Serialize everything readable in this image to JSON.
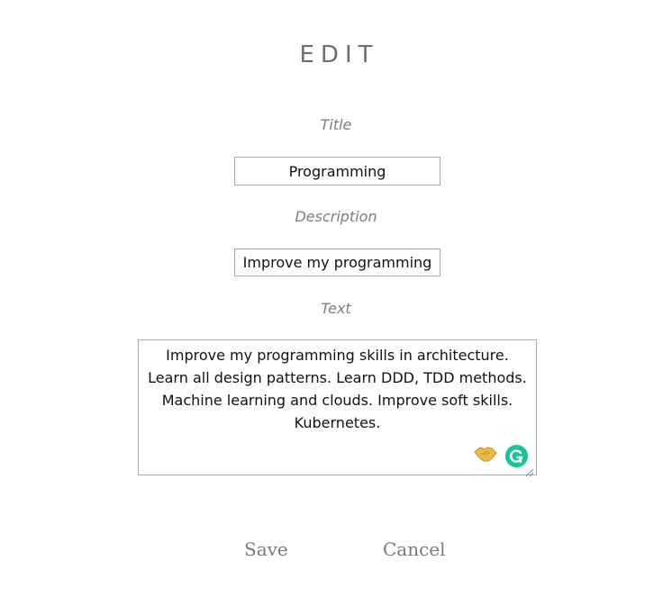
{
  "heading": "EDIT",
  "form": {
    "title_label": "Title",
    "title_value": "Programming",
    "description_label": "Description",
    "description_value": "Improve my programming",
    "text_label": "Text",
    "text_value": "Improve my programming skills in architecture. Learn all design patterns. Learn DDD, TDD methods. Machine learning and clouds. Improve soft skills. Kubernetes."
  },
  "actions": {
    "save_label": "Save",
    "cancel_label": "Cancel"
  },
  "colors": {
    "grammarly": "#15c39a",
    "handshake": "#f0b84a"
  }
}
